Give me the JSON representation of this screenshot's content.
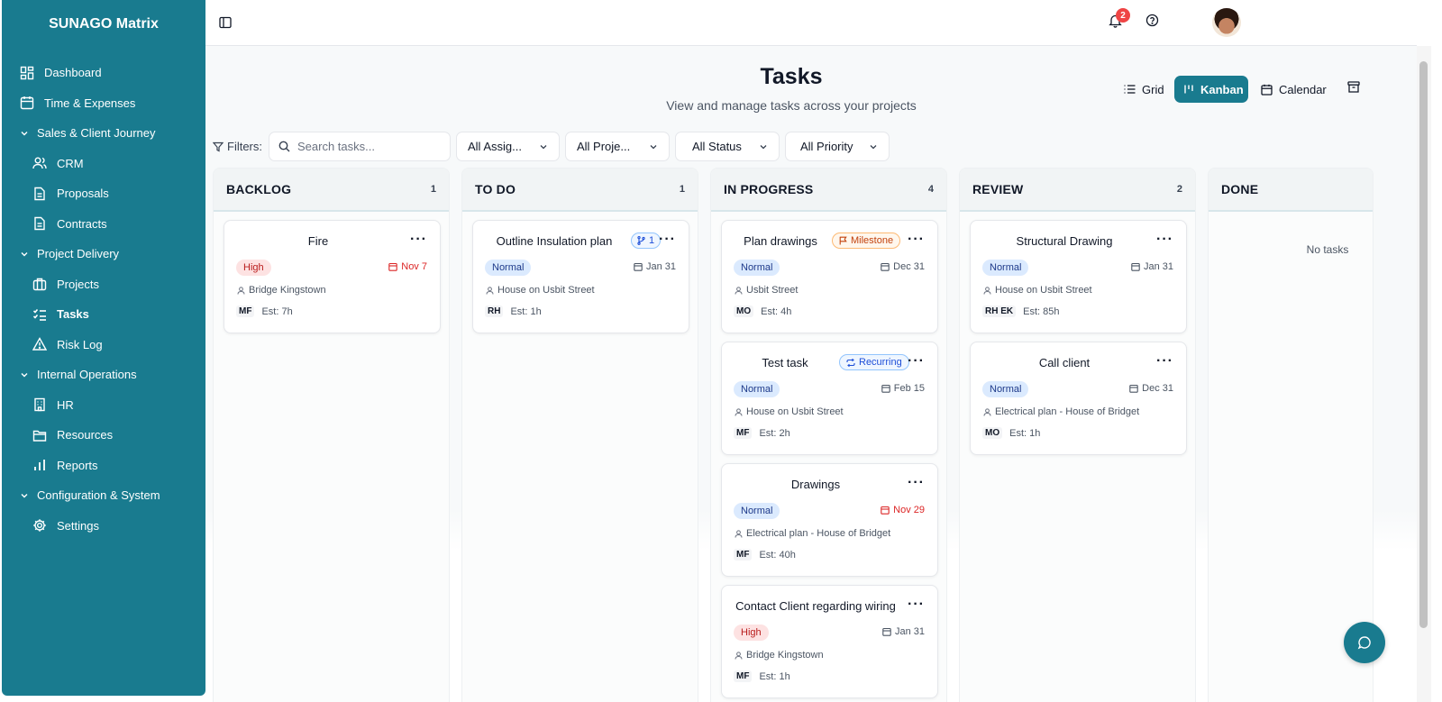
{
  "app": {
    "brand": "SUNAGO Matrix"
  },
  "sidebar": {
    "items": [
      {
        "label": "Dashboard"
      },
      {
        "label": "Time & Expenses"
      },
      {
        "label": "Sales & Client Journey"
      },
      {
        "label": "CRM"
      },
      {
        "label": "Proposals"
      },
      {
        "label": "Contracts"
      },
      {
        "label": "Project Delivery"
      },
      {
        "label": "Projects"
      },
      {
        "label": "Tasks"
      },
      {
        "label": "Risk Log"
      },
      {
        "label": "Internal Operations"
      },
      {
        "label": "HR"
      },
      {
        "label": "Resources"
      },
      {
        "label": "Reports"
      },
      {
        "label": "Configuration & System"
      },
      {
        "label": "Settings"
      }
    ]
  },
  "topbar": {
    "notification_count": "2"
  },
  "page": {
    "title": "Tasks",
    "subtitle": "View and manage tasks across your projects"
  },
  "views": {
    "grid": "Grid",
    "kanban": "Kanban",
    "calendar": "Calendar"
  },
  "filters": {
    "label": "Filters:",
    "search_placeholder": "Search tasks...",
    "assignee": "All Assig...",
    "project": "All Proje...",
    "status": "All Status",
    "priority": "All Priority"
  },
  "columns": [
    {
      "title": "BACKLOG",
      "count": "1",
      "cards": [
        {
          "title": "Fire",
          "priority": "High",
          "due": "Nov 7",
          "project": "Bridge Kingstown",
          "assignee": "MF",
          "estimate": "Est: 7h"
        }
      ]
    },
    {
      "title": "TO DO",
      "count": "1",
      "cards": [
        {
          "title": "Outline Insulation plan",
          "subtasks": "1",
          "priority": "Normal",
          "due": "Jan 31",
          "project": "House on Usbit Street",
          "assignee": "RH",
          "estimate": "Est: 1h"
        }
      ]
    },
    {
      "title": "IN PROGRESS",
      "count": "4",
      "cards": [
        {
          "title": "Plan drawings",
          "tag": "Milestone",
          "priority": "Normal",
          "due": "Dec 31",
          "project": "Usbit Street",
          "assignee": "MO",
          "estimate": "Est: 4h"
        },
        {
          "title": "Test task",
          "tag": "Recurring",
          "priority": "Normal",
          "due": "Feb 15",
          "project": "House on Usbit Street",
          "assignee": "MF",
          "estimate": "Est: 2h"
        },
        {
          "title": "Drawings",
          "priority": "Normal",
          "due": "Nov 29",
          "project": "Electrical plan - House of Bridget",
          "assignee": "MF",
          "estimate": "Est: 40h"
        },
        {
          "title": "Contact Client regarding wiring",
          "priority": "High",
          "due": "Jan 31",
          "project": "Bridge Kingstown",
          "assignee": "MF",
          "estimate": "Est: 1h"
        }
      ]
    },
    {
      "title": "REVIEW",
      "count": "2",
      "cards": [
        {
          "title": "Structural Drawing",
          "priority": "Normal",
          "due": "Jan 31",
          "project": "House on Usbit Street",
          "assignee": "RH EK",
          "estimate": "Est: 85h"
        },
        {
          "title": "Call client",
          "priority": "Normal",
          "due": "Dec 31",
          "project": "Electrical plan - House of Bridget",
          "assignee": "MO",
          "estimate": "Est: 1h"
        }
      ]
    },
    {
      "title": "DONE",
      "count": "",
      "empty_text": "No tasks",
      "cards": []
    }
  ],
  "colors": {
    "brand": "#197b8f",
    "danger": "#dc2626",
    "normal_pill": "#dbeafe",
    "high_pill": "#fde2e2"
  }
}
